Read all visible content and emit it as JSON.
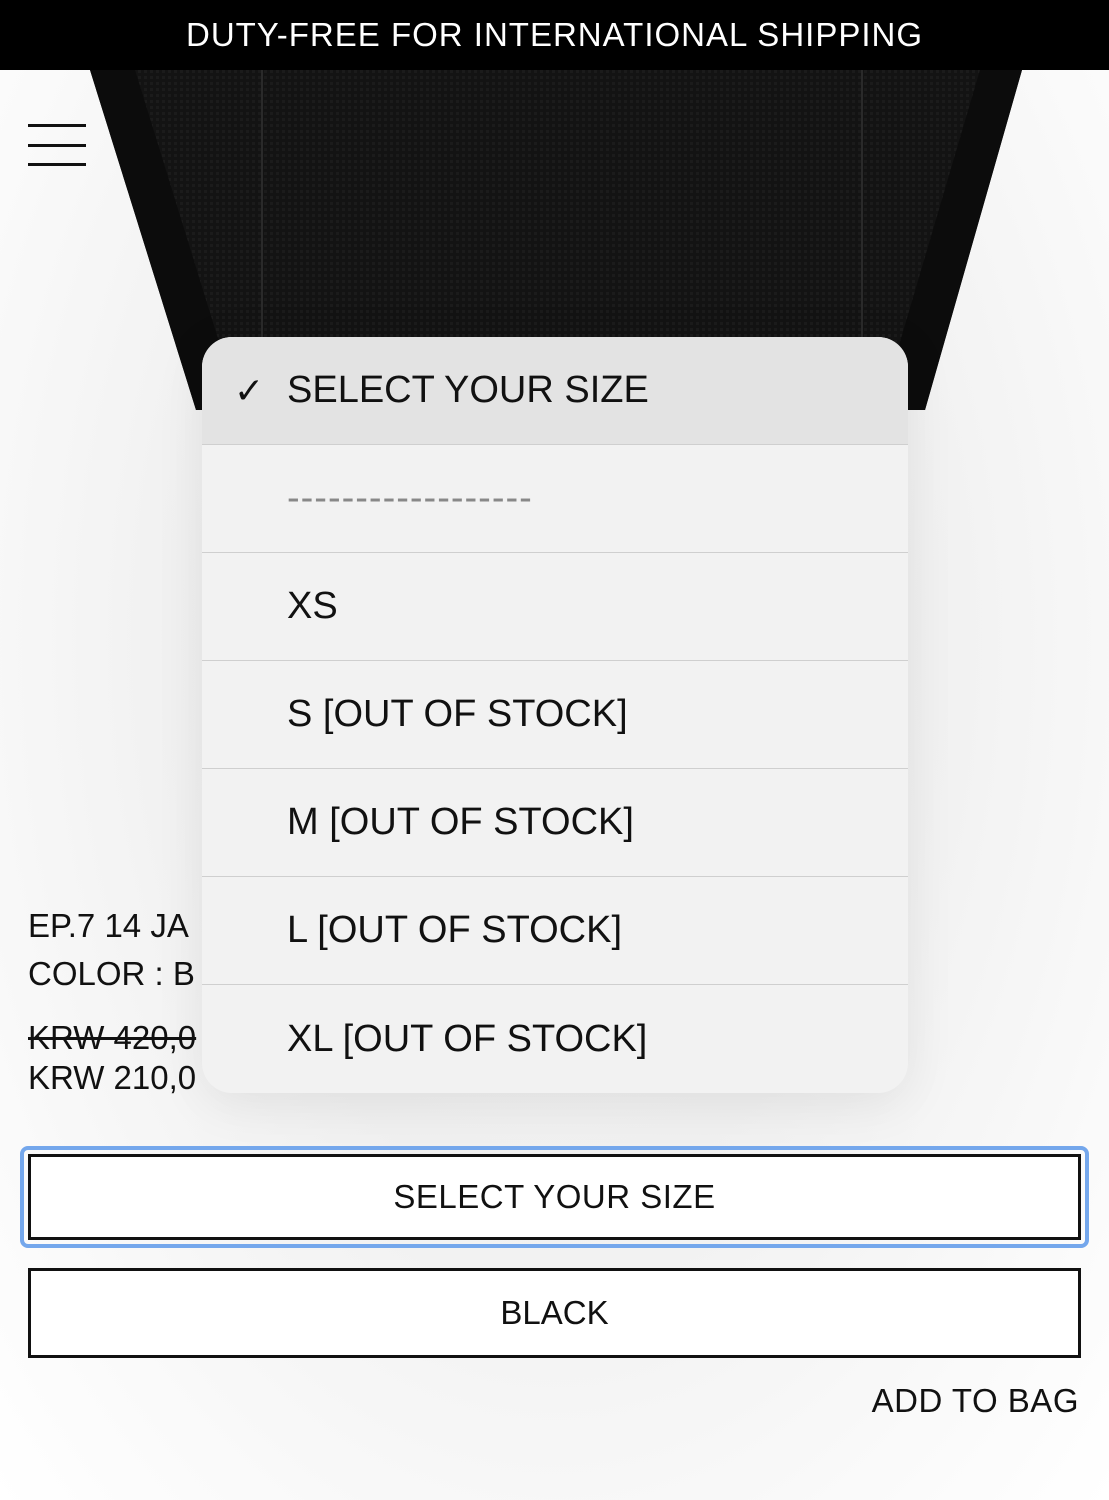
{
  "announcement": {
    "text": "DUTY-FREE FOR INTERNATIONAL SHIPPING"
  },
  "header": {
    "menu_icon": "hamburger-menu-icon"
  },
  "product": {
    "name": "EP.7 14 JA",
    "color_line": "COLOR : B",
    "price_original": "KRW 420,0",
    "price_sale": "KRW 210,0"
  },
  "size_select": {
    "label": "SELECT YOUR SIZE"
  },
  "color_select": {
    "label": "BLACK"
  },
  "actions": {
    "add_to_bag": "ADD TO BAG"
  },
  "picker": {
    "checkmark": "✓",
    "options": [
      {
        "label": "SELECT YOUR SIZE",
        "selected": true
      },
      {
        "label": "------------------",
        "selected": false
      },
      {
        "label": "XS",
        "selected": false
      },
      {
        "label": "S [OUT OF STOCK]",
        "selected": false
      },
      {
        "label": "M [OUT OF STOCK]",
        "selected": false
      },
      {
        "label": "L [OUT OF STOCK]",
        "selected": false
      },
      {
        "label": "XL [OUT OF STOCK]",
        "selected": false
      }
    ]
  },
  "colors": {
    "announcement_bg": "#000000",
    "focus_ring": "#74a7ec",
    "picker_bg": "#f2f2f2"
  }
}
